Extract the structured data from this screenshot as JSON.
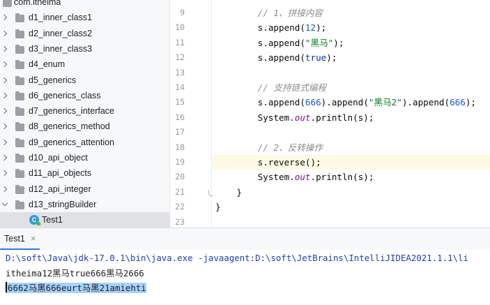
{
  "project_tree": {
    "items": [
      {
        "label": "com.itheima",
        "kind": "package",
        "expanded": true
      },
      {
        "label": "d1_inner_class1",
        "kind": "folder",
        "expanded": false
      },
      {
        "label": "d2_inner_class2",
        "kind": "folder",
        "expanded": false
      },
      {
        "label": "d3_inner_class3",
        "kind": "folder",
        "expanded": false
      },
      {
        "label": "d4_enum",
        "kind": "folder",
        "expanded": false
      },
      {
        "label": "d5_generics",
        "kind": "folder",
        "expanded": false
      },
      {
        "label": "d6_generics_class",
        "kind": "folder",
        "expanded": false
      },
      {
        "label": "d7_generics_interface",
        "kind": "folder",
        "expanded": false
      },
      {
        "label": "d8_generics_method",
        "kind": "folder",
        "expanded": false
      },
      {
        "label": "d9_generics_attention",
        "kind": "folder",
        "expanded": false
      },
      {
        "label": "d10_api_object",
        "kind": "folder",
        "expanded": false
      },
      {
        "label": "d11_api_objects",
        "kind": "folder",
        "expanded": false
      },
      {
        "label": "d12_api_integer",
        "kind": "folder",
        "expanded": false
      },
      {
        "label": "d13_stringBuilder",
        "kind": "folder",
        "expanded": true
      },
      {
        "label": "Test1",
        "kind": "class",
        "selected": true
      }
    ],
    "class_icon_letter": "C"
  },
  "editor": {
    "current_line": "19",
    "lines": [
      {
        "num": "9",
        "text": "        // 1、拼接内容"
      },
      {
        "num": "10",
        "text": "        s.append(12);"
      },
      {
        "num": "11",
        "text": "        s.append(\"黑马\");"
      },
      {
        "num": "12",
        "text": "        s.append(true);"
      },
      {
        "num": "13",
        "text": ""
      },
      {
        "num": "14",
        "text": "        // 支持链式编程"
      },
      {
        "num": "15",
        "text": "        s.append(666).append(\"黑马2\").append(666);"
      },
      {
        "num": "16",
        "text": "        System.out.println(s);"
      },
      {
        "num": "17",
        "text": ""
      },
      {
        "num": "18",
        "text": "        // 2、反转操作"
      },
      {
        "num": "19",
        "text": "        s.reverse();"
      },
      {
        "num": "20",
        "text": "        System.out.println(s);"
      },
      {
        "num": "21",
        "text": "    }"
      },
      {
        "num": "22",
        "text": "}"
      },
      {
        "num": "23",
        "text": ""
      }
    ]
  },
  "run_panel": {
    "tab_label": "Test1",
    "close_glyph": "×",
    "console": {
      "command": "D:\\soft\\Java\\jdk-17.0.1\\bin\\java.exe -javaagent:D:\\soft\\JetBrains\\IntelliJIDEA2021.1.1\\li",
      "output_line_1": "itheima12黑马true666黑马2666",
      "output_line_2": "6662马黑666eurt马黑21amiehti"
    }
  },
  "colors": {
    "comment": "#8c8c8c",
    "number": "#1750eb",
    "string": "#067d17",
    "keyword": "#0033b3",
    "static_field": "#871094",
    "current_line": "#fdf9e4",
    "selection": "#a6d2ff",
    "console_command": "#1e3fbd"
  }
}
